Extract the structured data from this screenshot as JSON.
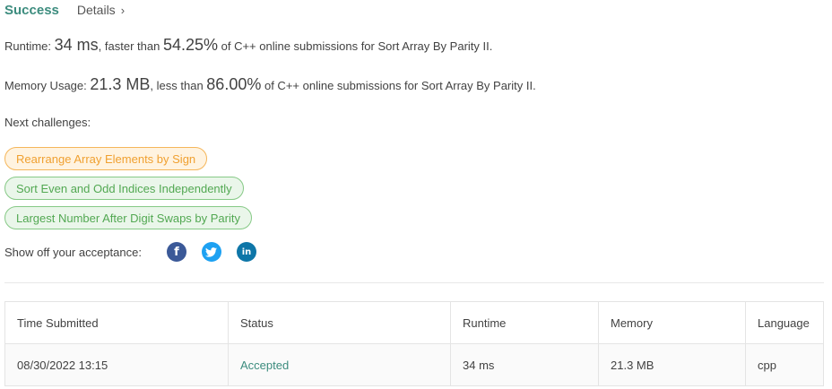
{
  "header": {
    "status_label": "Success",
    "details_label": "Details",
    "details_chevron": "›"
  },
  "runtime": {
    "prefix": "Runtime: ",
    "value": "34 ms",
    "middle": ", faster than ",
    "percent": "54.25%",
    "suffix": " of C++ online submissions for Sort Array By Parity II."
  },
  "memory": {
    "prefix": "Memory Usage: ",
    "value": "21.3 MB",
    "middle": ", less than ",
    "percent": "86.00%",
    "suffix": " of C++ online submissions for Sort Array By Parity II."
  },
  "next_challenges": {
    "title": "Next challenges:",
    "items": [
      {
        "label": "Rearrange Array Elements by Sign",
        "difficulty_color": "#f0a030"
      },
      {
        "label": "Sort Even and Odd Indices Independently",
        "difficulty_color": "#52a852"
      },
      {
        "label": "Largest Number After Digit Swaps by Parity",
        "difficulty_color": "#52a852"
      }
    ]
  },
  "share": {
    "label": "Show off your acceptance:",
    "icons": [
      {
        "name": "facebook-icon",
        "glyph": "f",
        "color": "#3b5998"
      },
      {
        "name": "twitter-icon",
        "glyph": "bird",
        "color": "#1da1f2"
      },
      {
        "name": "linkedin-icon",
        "glyph": "in",
        "color": "#0e76a8"
      }
    ]
  },
  "submissions": {
    "columns": [
      "Time Submitted",
      "Status",
      "Runtime",
      "Memory",
      "Language"
    ],
    "rows": [
      {
        "time_submitted": "08/30/2022 13:15",
        "status": "Accepted",
        "runtime": "34 ms",
        "memory": "21.3 MB",
        "language": "cpp"
      }
    ]
  },
  "colors": {
    "success": "#3c8c7e",
    "accepted": "#3c8c7e",
    "medium_chip_border": "#f5b65a",
    "easy_chip_border": "#86c986"
  }
}
